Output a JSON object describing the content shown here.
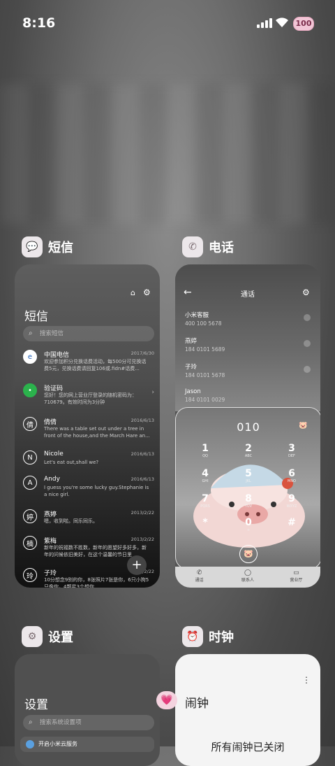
{
  "status_bar": {
    "time": "8:16",
    "battery": "100"
  },
  "sms_app": {
    "title": "短信",
    "header": "短信",
    "search_placeholder": "搜索短信",
    "conversations": [
      {
        "name": "中国电信",
        "date": "2017/6/30",
        "message": "欢迎参加积分兑换话费活动，每500分可兑换话费5元，兑换话费请回复106或.fidn#话费..."
      },
      {
        "name": "验证码",
        "date": "",
        "message": "您好！您的网上营业厅登录的随机密码为：710679。有效时间为3分钟"
      },
      {
        "name": "倩倩",
        "date": "2016/6/13",
        "message": "There was a table set out under a tree in front of the house,and the March Hare an..."
      },
      {
        "name": "Nicole",
        "date": "2016/6/13",
        "message": "Let's eat out,shall we?"
      },
      {
        "name": "Andy",
        "date": "2016/6/13",
        "message": "I guess you're some lucky guy.Stephanie is a nice girl."
      },
      {
        "name": "燕婷",
        "date": "2013/2/22",
        "message": "嗯，收到啦。同乐同乐。"
      },
      {
        "name": "紫梅",
        "date": "2013/2/22",
        "message": "新年的祝福数不胜数，新年的愿望好多好多，新年的问候依旧美好，在这个温馨的节日里"
      },
      {
        "name": "子玲",
        "date": "2013/2/22",
        "message": "10分想念9别的你，8张照片7张是你，6只小狗5只像你，4颗星3个想你"
      }
    ],
    "avatars": [
      "倩",
      "N",
      "A",
      "婷",
      "楠",
      "玲"
    ]
  },
  "phone_app": {
    "title": "电话",
    "header": "通话",
    "contacts": [
      {
        "name": "小米客服",
        "number": "400 100 5678"
      },
      {
        "name": "燕婷",
        "number": "184 0101 5689"
      },
      {
        "name": "子玲",
        "number": "184 0101 5678"
      },
      {
        "name": "Jason",
        "number": "184 0101 0029"
      }
    ],
    "dial_display": "010",
    "keys": [
      {
        "d": "1",
        "l": "QQ"
      },
      {
        "d": "2",
        "l": "ABC"
      },
      {
        "d": "3",
        "l": "DEF"
      },
      {
        "d": "4",
        "l": "GHI"
      },
      {
        "d": "5",
        "l": "JKL"
      },
      {
        "d": "6",
        "l": "MNO"
      },
      {
        "d": "7",
        "l": "PQRS"
      },
      {
        "d": "8",
        "l": "TUV"
      },
      {
        "d": "9",
        "l": "WXYZ"
      },
      {
        "d": "*",
        "l": ""
      },
      {
        "d": "0",
        "l": "+"
      },
      {
        "d": "#",
        "l": ""
      }
    ],
    "tabs": [
      "通话",
      "联系人",
      "营业厅"
    ]
  },
  "settings_app": {
    "title": "设置",
    "header": "设置",
    "search_placeholder": "搜索系统设置项",
    "first_item": "开启小米云服务"
  },
  "clock_app": {
    "title": "时钟",
    "header": "闹钟",
    "status": "所有闹钟已关闭"
  }
}
